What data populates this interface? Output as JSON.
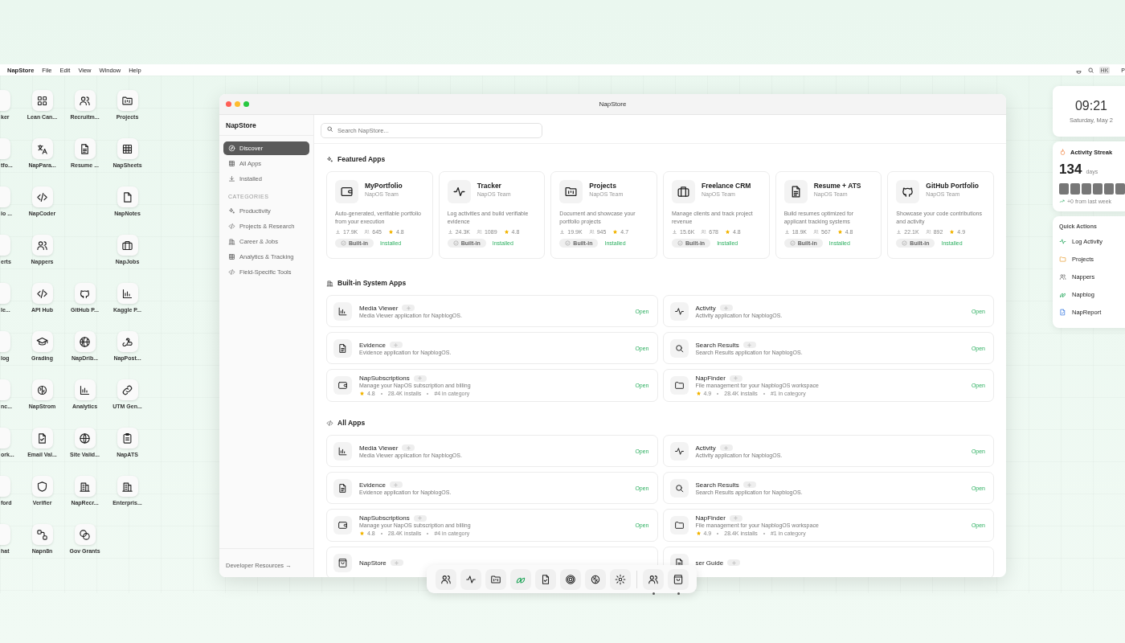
{
  "menu_bar": {
    "app_name": "NapStore",
    "menus": [
      "File",
      "Edit",
      "View",
      "Window",
      "Help"
    ],
    "avatar": "HK",
    "trailing": "P"
  },
  "desktop_icons": [
    {
      "kind": "app",
      "label": "ker"
    },
    {
      "kind": "app",
      "label": "Lean Can..."
    },
    {
      "kind": "app",
      "label": "Recruitm..."
    },
    {
      "kind": "app",
      "label": "Projects"
    },
    {
      "kind": "app",
      "label": "tfo..."
    },
    {
      "kind": "app",
      "label": "NapPara..."
    },
    {
      "kind": "app",
      "label": "Resume ..."
    },
    {
      "kind": "app",
      "label": "NapSheets"
    },
    {
      "kind": "app",
      "label": "io ..."
    },
    {
      "kind": "app",
      "label": "NapCoder"
    },
    {
      "kind": "blank"
    },
    {
      "kind": "app",
      "label": "NapNotes"
    },
    {
      "kind": "app",
      "label": "erts"
    },
    {
      "kind": "app",
      "label": "Nappers"
    },
    {
      "kind": "blank"
    },
    {
      "kind": "app",
      "label": "NapJobs"
    },
    {
      "kind": "app",
      "label": "le..."
    },
    {
      "kind": "app",
      "label": "API Hub"
    },
    {
      "kind": "app",
      "label": "GitHub P..."
    },
    {
      "kind": "app",
      "label": "Kaggle P..."
    },
    {
      "kind": "app",
      "label": "log"
    },
    {
      "kind": "app",
      "label": "Grading"
    },
    {
      "kind": "app",
      "label": "NapDrib..."
    },
    {
      "kind": "app",
      "label": "NapPost..."
    },
    {
      "kind": "app",
      "label": "nc..."
    },
    {
      "kind": "app",
      "label": "NapStrom"
    },
    {
      "kind": "app",
      "label": "Analytics"
    },
    {
      "kind": "app",
      "label": "UTM Gen..."
    },
    {
      "kind": "app",
      "label": "ork..."
    },
    {
      "kind": "app",
      "label": "Email Val..."
    },
    {
      "kind": "app",
      "label": "Site Valid..."
    },
    {
      "kind": "app",
      "label": "NapATS"
    },
    {
      "kind": "app",
      "label": "ford"
    },
    {
      "kind": "app",
      "label": "Verifier"
    },
    {
      "kind": "app",
      "label": "NapRecr..."
    },
    {
      "kind": "app",
      "label": "Enterpris..."
    },
    {
      "kind": "app",
      "label": "hat"
    },
    {
      "kind": "app",
      "label": "Napn8n"
    },
    {
      "kind": "app",
      "label": "Gov Grants"
    },
    {
      "kind": "blank"
    }
  ],
  "window": {
    "title": "NapStore",
    "sidebar": {
      "title": "NapStore",
      "nav": [
        {
          "label": "Discover",
          "selected": true
        },
        {
          "label": "All Apps",
          "selected": false
        },
        {
          "label": "Installed",
          "selected": false
        }
      ],
      "categories_heading": "CATEGORIES",
      "categories": [
        {
          "label": "Productivity",
          "selected": false
        },
        {
          "label": "Projects & Research",
          "selected": false
        },
        {
          "label": "Career & Jobs",
          "selected": false
        },
        {
          "label": "Analytics & Tracking",
          "selected": false
        },
        {
          "label": "Field-Specific Tools",
          "selected": false
        }
      ],
      "footer": "Developer Resources →"
    },
    "search": {
      "placeholder": "Search NapStore..."
    },
    "featured": {
      "heading": "Featured Apps",
      "apps": [
        {
          "title": "MyPortfolio",
          "publisher": "NapOS Team",
          "description": "Auto-generated, verifiable portfolio from your execution",
          "downloads": "17.9K",
          "users": "645",
          "rating": "4.8",
          "badge": "Built-in",
          "status": "Installed"
        },
        {
          "title": "Tracker",
          "publisher": "NapOS Team",
          "description": "Log activities and build verifiable evidence",
          "downloads": "24.3K",
          "users": "1089",
          "rating": "4.8",
          "badge": "Built-in",
          "status": "Installed"
        },
        {
          "title": "Projects",
          "publisher": "NapOS Team",
          "description": "Document and showcase your portfolio projects",
          "downloads": "19.9K",
          "users": "945",
          "rating": "4.7",
          "badge": "Built-in",
          "status": "Installed"
        },
        {
          "title": "Freelance CRM",
          "publisher": "NapOS Team",
          "description": "Manage clients and track project revenue",
          "downloads": "15.6K",
          "users": "678",
          "rating": "4.8",
          "badge": "Built-in",
          "status": "Installed"
        },
        {
          "title": "Resume + ATS",
          "publisher": "NapOS Team",
          "description": "Build resumes optimized for applicant tracking systems",
          "downloads": "18.9K",
          "users": "567",
          "rating": "4.8",
          "badge": "Built-in",
          "status": "Installed"
        },
        {
          "title": "GitHub Portfolio",
          "publisher": "NapOS Team",
          "description": "Showcase your code contributions and activity",
          "downloads": "22.1K",
          "users": "892",
          "rating": "4.9",
          "badge": "Built-in",
          "status": "Installed"
        }
      ]
    },
    "system_apps": {
      "heading": "Built-in System Apps",
      "apps": [
        {
          "title": "Media Viewer",
          "description": "Media Viewer application for NapblogOS.",
          "action": "Open"
        },
        {
          "title": "Activity",
          "description": "Activity application for NapblogOS.",
          "action": "Open"
        },
        {
          "title": "Evidence",
          "description": "Evidence application for NapblogOS.",
          "action": "Open"
        },
        {
          "title": "Search Results",
          "description": "Search Results application for NapblogOS.",
          "action": "Open"
        },
        {
          "title": "NapSubscriptions",
          "description": "Manage your NapOS subscription and billing",
          "rating": "4.8",
          "installs": "28.4K installs",
          "rank": "#4 in category",
          "action": "Open"
        },
        {
          "title": "NapFinder",
          "description": "File management for your NapblogOS workspace",
          "rating": "4.9",
          "installs": "28.4K installs",
          "rank": "#1 in category",
          "action": "Open"
        }
      ]
    },
    "all_apps": {
      "heading": "All Apps",
      "apps": [
        {
          "title": "Media Viewer",
          "description": "Media Viewer application for NapblogOS.",
          "action": "Open"
        },
        {
          "title": "Activity",
          "description": "Activity application for NapblogOS.",
          "action": "Open"
        },
        {
          "title": "Evidence",
          "description": "Evidence application for NapblogOS.",
          "action": "Open"
        },
        {
          "title": "Search Results",
          "description": "Search Results application for NapblogOS.",
          "action": "Open"
        },
        {
          "title": "NapSubscriptions",
          "description": "Manage your NapOS subscription and billing",
          "rating": "4.8",
          "installs": "28.4K installs",
          "rank": "#4 in category",
          "action": "Open"
        },
        {
          "title": "NapFinder",
          "description": "File management for your NapblogOS workspace",
          "rating": "4.9",
          "installs": "28.4K installs",
          "rank": "#1 in category",
          "action": "Open"
        },
        {
          "title": "NapStore"
        },
        {
          "title": "ser Guide"
        }
      ]
    }
  },
  "dock": [
    {
      "running": false
    },
    {
      "running": false
    },
    {
      "running": false
    },
    {
      "running": false
    },
    {
      "running": false
    },
    {
      "running": false
    },
    {
      "running": false
    },
    {
      "running": false
    },
    {
      "running": true
    },
    {
      "running": true
    }
  ],
  "clock": {
    "time": "09:21",
    "date": "Saturday, May 2"
  },
  "streak": {
    "title": "Activity Streak",
    "count": "134",
    "unit": "days",
    "days": [
      {
        "active": false
      },
      {
        "active": false
      },
      {
        "active": false
      },
      {
        "active": false
      },
      {
        "active": false
      },
      {
        "active": false
      }
    ],
    "change": "+0 from last week"
  },
  "quick_actions": {
    "title": "Quick Actions",
    "items": [
      "Log Activity",
      "Projects",
      "Nappers",
      "Napblog",
      "NapReport"
    ]
  }
}
